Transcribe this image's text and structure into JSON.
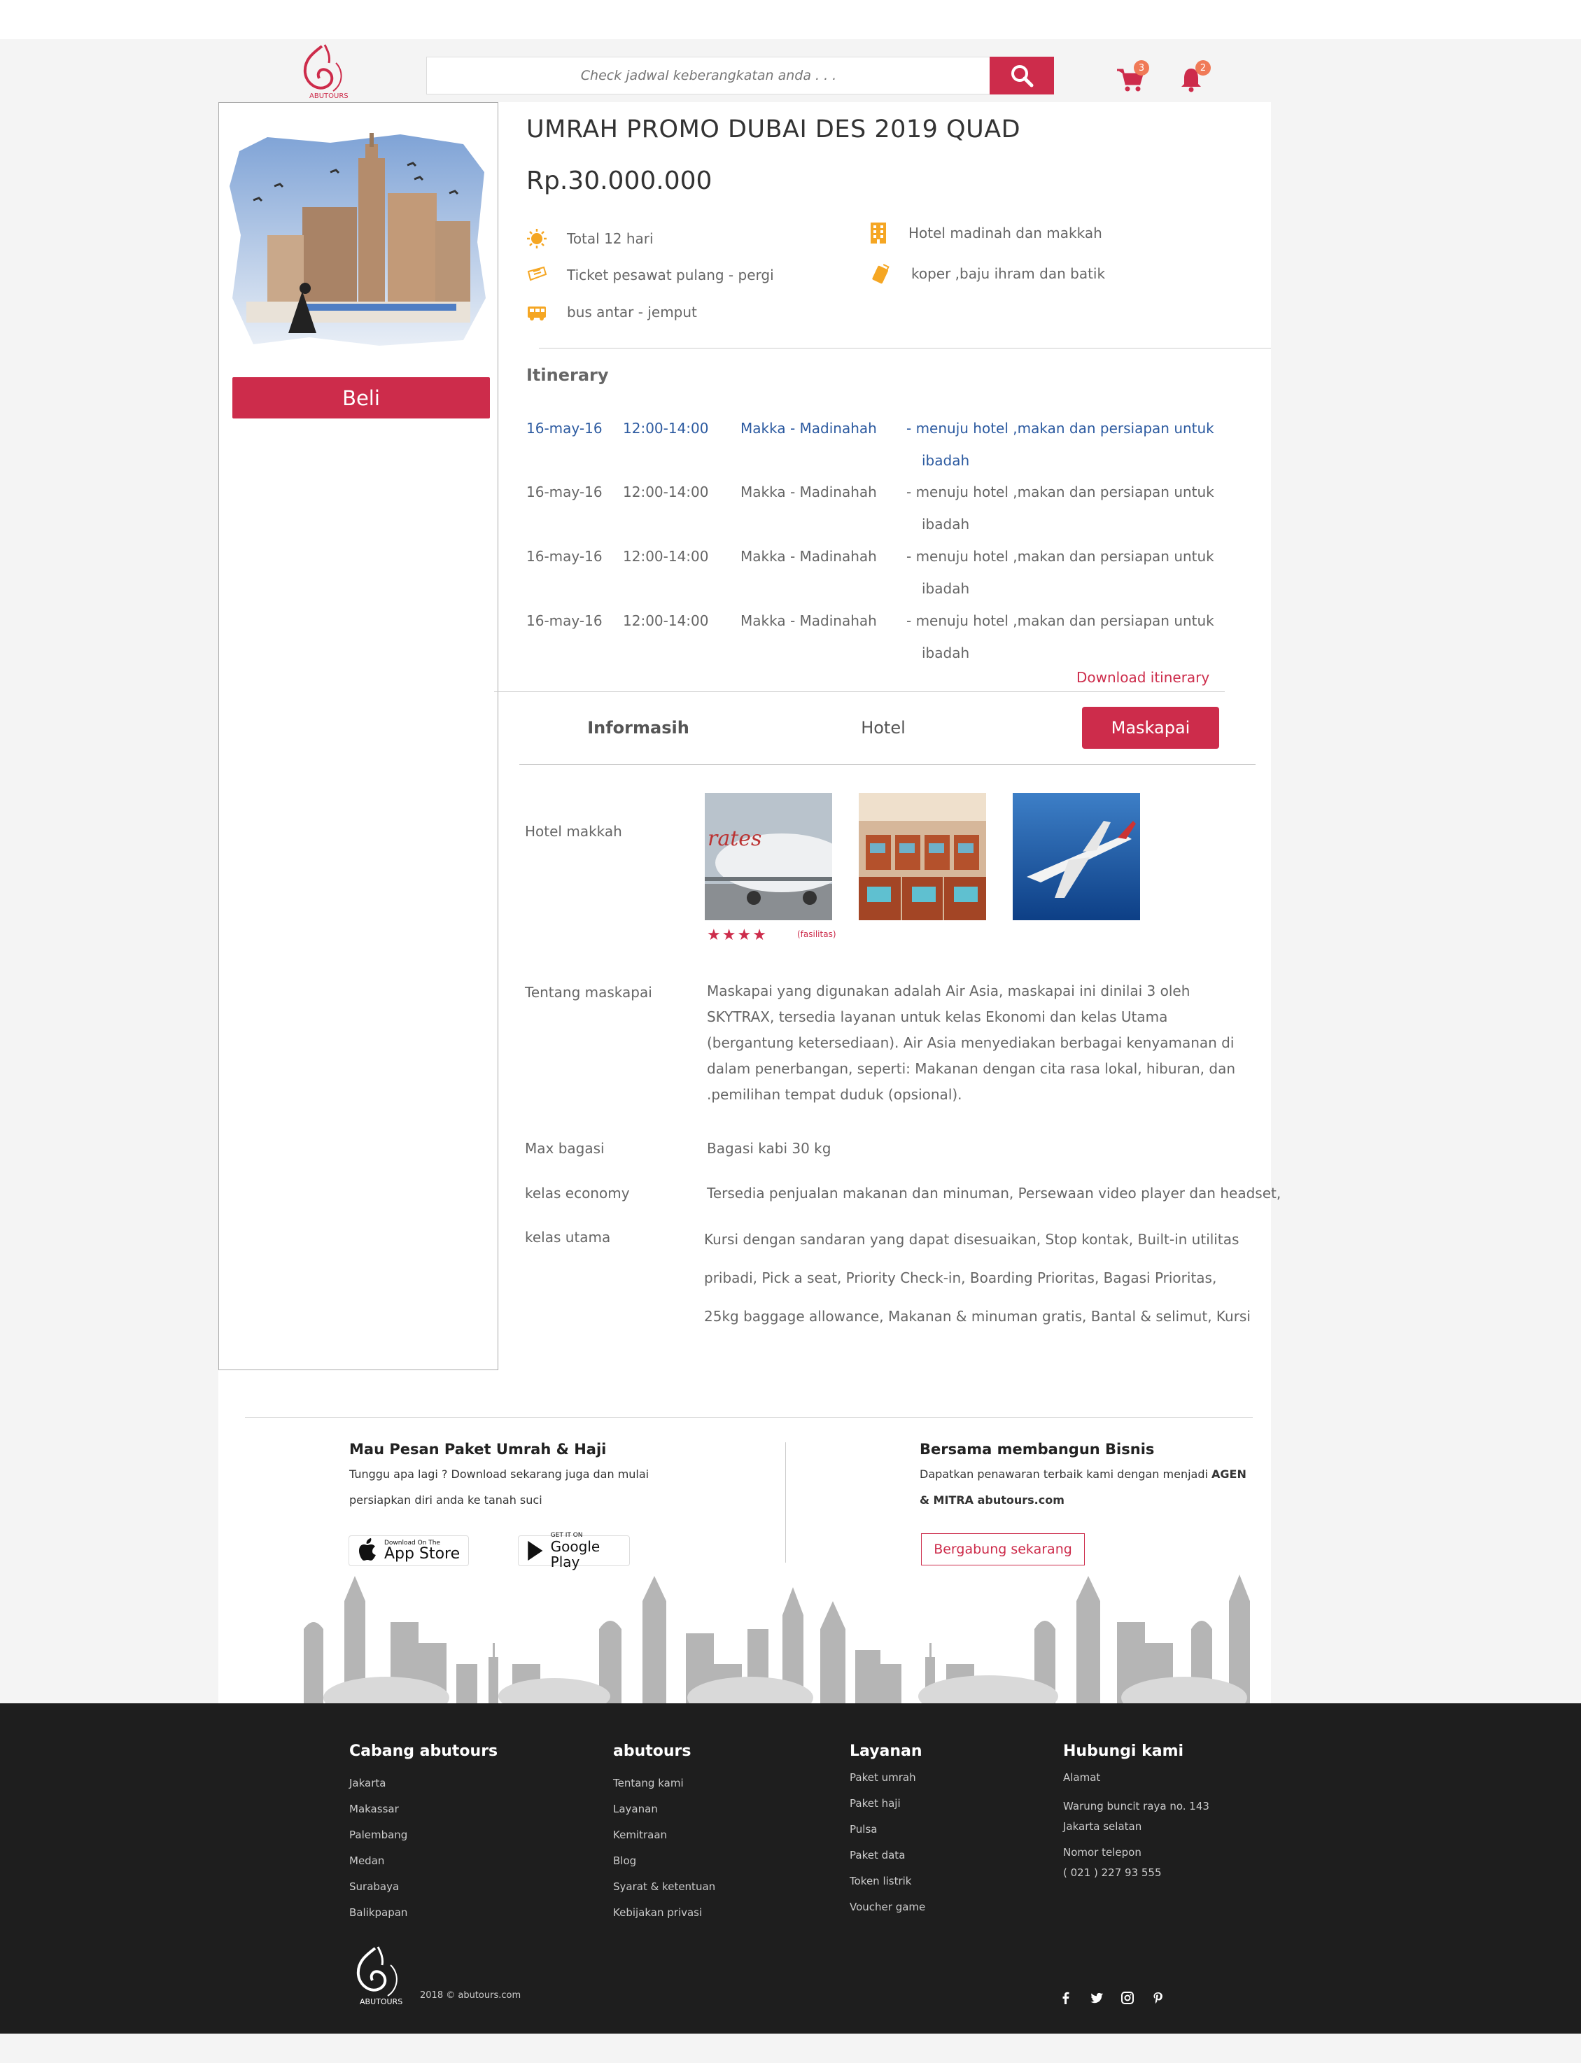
{
  "header": {
    "search_placeholder": "Check jadwal keberangkatan anda . . .",
    "cart_count": "3",
    "notif_count": "2",
    "logo_text": "ABUTOURS"
  },
  "package": {
    "title": "UMRAH PROMO DUBAI DES 2019 QUAD",
    "price": "Rp.30.000.000",
    "buy_label": "Beli",
    "features": [
      "Total 12 hari",
      "Ticket pesawat pulang - pergi",
      "bus antar - jemput",
      "Hotel madinah dan makkah",
      "koper ,baju ihram dan batik"
    ]
  },
  "itinerary": {
    "title": "Itinerary",
    "rows": [
      {
        "date": "16-may-16",
        "time": "12:00-14:00",
        "route": "Makka - Madinahah",
        "desc": "- menuju hotel ,makan dan persiapan untuk",
        "desc2": "ibadah"
      },
      {
        "date": "16-may-16",
        "time": "12:00-14:00",
        "route": "Makka - Madinahah",
        "desc": "- menuju hotel ,makan dan persiapan untuk",
        "desc2": "ibadah"
      },
      {
        "date": "16-may-16",
        "time": "12:00-14:00",
        "route": "Makka - Madinahah",
        "desc": "- menuju hotel ,makan dan persiapan untuk",
        "desc2": "ibadah"
      },
      {
        "date": "16-may-16",
        "time": "12:00-14:00",
        "route": "Makka - Madinahah",
        "desc": "- menuju hotel ,makan dan persiapan untuk",
        "desc2": "ibadah"
      }
    ],
    "download_label": "Download itinerary"
  },
  "tabs": {
    "informasi": "Informasih",
    "hotel": "Hotel",
    "maskapai": "Maskapai",
    "active": "Maskapai"
  },
  "airline": {
    "hotel_label": "Hotel makkah",
    "rating": 4,
    "fasilitas_label": "(fasilitas)",
    "about_label": "Tentang maskapai",
    "about_text": "Maskapai yang digunakan adalah Air Asia, maskapai ini dinilai 3 oleh SKYTRAX, tersedia layanan untuk kelas Ekonomi dan kelas Utama (bergantung ketersediaan). Air Asia menyediakan berbagai kenyamanan di dalam penerbangan, seperti: Makanan dengan cita rasa lokal, hiburan, dan .pemilihan tempat duduk (opsional).",
    "baggage_label": "Max bagasi",
    "baggage_value": "Bagasi kabi 30 kg",
    "economy_label": "kelas economy",
    "economy_value": "Tersedia penjualan makanan dan minuman, Persewaan video player dan headset,",
    "business_label": "kelas utama",
    "business_line1": "Kursi dengan sandaran yang dapat disesuaikan, Stop kontak, Built-in utilitas",
    "business_line2": "pribadi, Pick a seat, Priority Check-in, Boarding Prioritas, Bagasi Prioritas,",
    "business_line3": "25kg baggage allowance, Makanan & minuman gratis, Bantal & selimut, Kursi"
  },
  "promo": {
    "left_title": "Mau Pesan Paket Umrah & Haji",
    "left_line1": "Tunggu apa lagi ? Download sekarang juga dan mulai",
    "left_line2": "persiapkan diri anda ke tanah suci",
    "appstore_small": "Download On The",
    "appstore_big": "App Store",
    "gplay_small": "GET IT ON",
    "gplay_big": "Google Play",
    "right_title": "Bersama membangun Bisnis",
    "right_line1_a": "Dapatkan penawaran terbaik kami dengan menjadi ",
    "right_line1_b": "AGEN",
    "right_line2": "& MITRA abutours.com",
    "join_label": "Bergabung sekarang"
  },
  "footer": {
    "col1": {
      "title": "Cabang abutours",
      "items": [
        "Jakarta",
        "Makassar",
        "Palembang",
        "Medan",
        "Surabaya",
        "Balikpapan"
      ]
    },
    "col2": {
      "title": "abutours",
      "items": [
        "Tentang kami",
        "Layanan",
        "Kemitraan",
        "Blog",
        "Syarat & ketentuan",
        "Kebijakan privasi"
      ]
    },
    "col3": {
      "title": "Layanan",
      "items": [
        "Paket umrah",
        "Paket haji",
        "Pulsa",
        "Paket data",
        "Token listrik",
        "Voucher game"
      ]
    },
    "col4": {
      "title": "Hubungi kami",
      "address_label": "Alamat",
      "address1": "Warung buncit raya no. 143",
      "address2": "Jakarta selatan",
      "phone_label": "Nomor telepon",
      "phone": "( 021 )  227 93 555"
    },
    "copyright": "2018 ©  abutours.com",
    "logo_text": "ABUTOURS"
  },
  "colors": {
    "accent": "#cd2c4b",
    "link_blue": "#2c5aa0",
    "footer_bg": "#1e1e1e",
    "badge": "#f07a57",
    "icon_orange": "#f5a623"
  }
}
